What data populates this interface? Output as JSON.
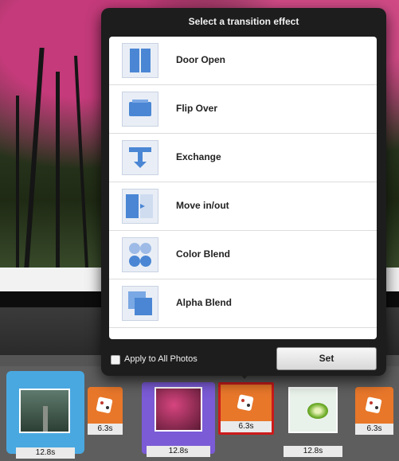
{
  "popup": {
    "title": "Select a transition effect",
    "effects": [
      {
        "label": "Door Open",
        "icon": "door-open-icon"
      },
      {
        "label": "Flip Over",
        "icon": "flip-over-icon"
      },
      {
        "label": "Exchange",
        "icon": "exchange-icon"
      },
      {
        "label": "Move in/out",
        "icon": "move-in-out-icon"
      },
      {
        "label": "Color Blend",
        "icon": "color-blend-icon"
      },
      {
        "label": "Alpha Blend",
        "icon": "alpha-blend-icon"
      }
    ],
    "apply_all_label": "Apply to All Photos",
    "apply_all_checked": false,
    "set_label": "Set"
  },
  "timeline": {
    "clips": [
      {
        "duration": "12.8s",
        "thumb": "forest-path",
        "selected": true
      },
      {
        "duration": "12.8s",
        "thumb": "pink-tree",
        "selected": true
      },
      {
        "duration": "12.8s",
        "thumb": "kiwi",
        "selected": false
      }
    ],
    "transitions": [
      {
        "duration": "6.3s",
        "selected": false
      },
      {
        "duration": "6.3s",
        "selected": true
      },
      {
        "duration": "6.3s",
        "selected": false
      }
    ]
  },
  "colors": {
    "popup_bg": "#1d1d1d",
    "transition_orange": "#e8772a",
    "selected_clip_blue": "#4aa8e0",
    "selected_transition_border": "#cc1b1b",
    "icon_blue": "#4a86d4"
  }
}
